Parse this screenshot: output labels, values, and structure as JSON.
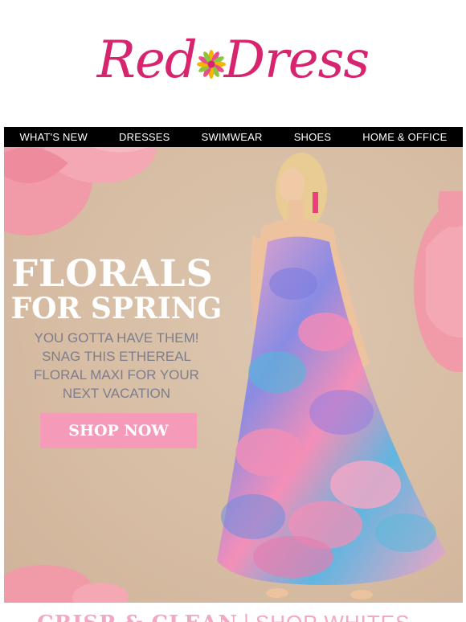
{
  "brand": {
    "logo_left": "Red",
    "logo_right": "Dress",
    "logo_color": "#d6246e"
  },
  "nav": {
    "items": [
      {
        "label": "WHAT'S NEW"
      },
      {
        "label": "DRESSES"
      },
      {
        "label": "SWIMWEAR"
      },
      {
        "label": "SHOES"
      },
      {
        "label": "HOME & OFFICE"
      }
    ]
  },
  "hero": {
    "headline_line1": "FLORALS",
    "headline_line2": "FOR SPRING",
    "subtext_lines": [
      "YOU GOTTA HAVE THEM!",
      "SNAG THIS ETHEREAL",
      "FLORAL MAXI FOR YOUR",
      "NEXT VACATION"
    ],
    "cta_label": "SHOP NOW",
    "cta_color": "#f59bb9",
    "background_color": "#d8bfa7",
    "subtext_color": "#7d7d8e",
    "image": "model-in-floral-maxi-dress"
  },
  "next_section": {
    "left": "CRISP & CLEAN",
    "separator": "|",
    "right": "SHOP WHITES",
    "color": "#f2a7c3"
  }
}
